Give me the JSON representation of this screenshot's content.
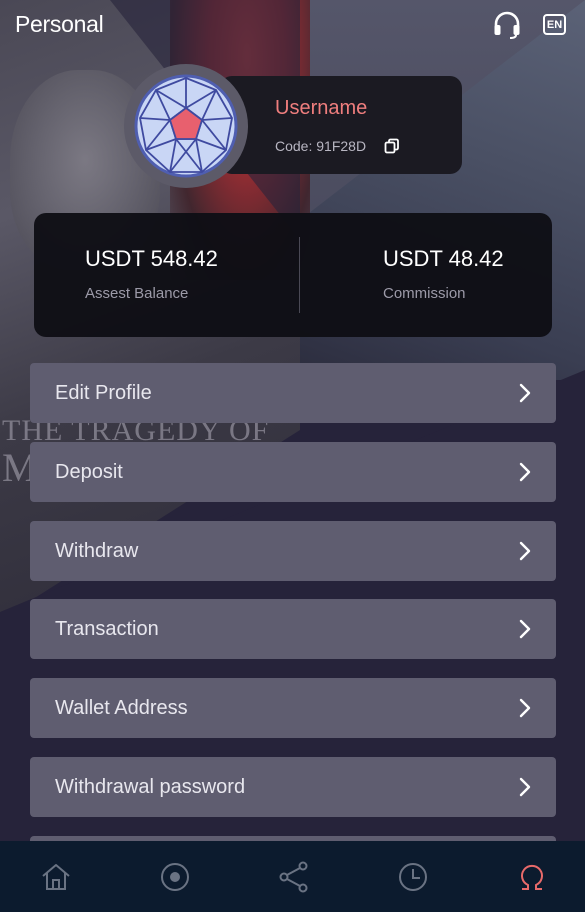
{
  "header": {
    "title": "Personal",
    "support_icon": "headset-icon",
    "language": "EN"
  },
  "profile": {
    "username": "Username",
    "code": "Code: 91F28D",
    "copy_icon": "copy-icon",
    "avatar_icon": "geodesic-sphere-icon"
  },
  "balances": {
    "asset_value": "USDT 548.42",
    "asset_label": "Assest Balance",
    "commission_value": "USDT 48.42",
    "commission_label": "Commission"
  },
  "background": {
    "poster_text_line1": "THE TRAGEDY OF",
    "poster_text_line2": "M"
  },
  "menu": {
    "items": [
      {
        "label": "Edit Profile"
      },
      {
        "label": "Deposit"
      },
      {
        "label": "Withdraw"
      },
      {
        "label": "Transaction"
      },
      {
        "label": "Wallet Address"
      },
      {
        "label": "Withdrawal password"
      }
    ]
  },
  "bottom_nav": {
    "items": [
      {
        "icon": "home-icon"
      },
      {
        "icon": "record-icon"
      },
      {
        "icon": "share-icon"
      },
      {
        "icon": "clock-icon"
      },
      {
        "icon": "profile-icon",
        "active": true
      }
    ],
    "active_color": "#e86a6a",
    "inactive_color": "#6a7383"
  },
  "colors": {
    "accent_username": "#ef7e7e",
    "menu_bg": "#5f5d70",
    "nav_bg": "#0c1b2e"
  }
}
